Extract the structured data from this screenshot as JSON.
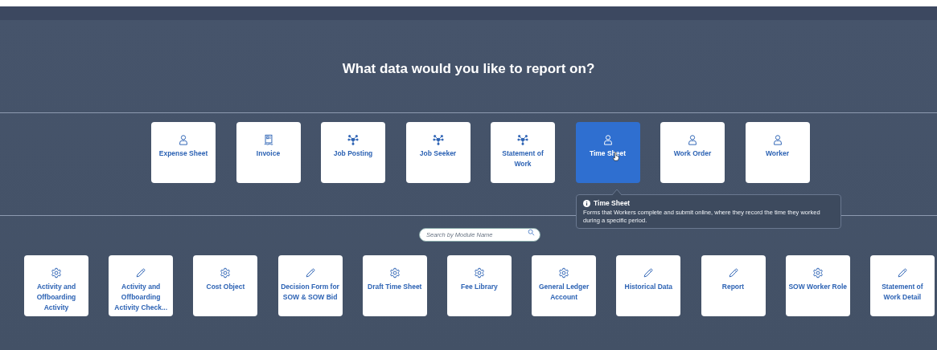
{
  "title": "What data would you like to report on?",
  "primary_modules": [
    {
      "label": "Expense Sheet",
      "kind": "user",
      "selected": false
    },
    {
      "label": "Invoice",
      "kind": "document",
      "selected": false
    },
    {
      "label": "Job Posting",
      "kind": "network",
      "selected": false
    },
    {
      "label": "Job Seeker",
      "kind": "network",
      "selected": false
    },
    {
      "label": "Statement of Work",
      "kind": "network",
      "selected": false
    },
    {
      "label": "Time Sheet",
      "kind": "user",
      "selected": true
    },
    {
      "label": "Work Order",
      "kind": "user",
      "selected": false
    },
    {
      "label": "Worker",
      "kind": "user",
      "selected": false
    }
  ],
  "tooltip": {
    "title": "Time Sheet",
    "text": "Forms that Workers complete and submit online, where they record the time they worked during a specific period."
  },
  "search": {
    "placeholder": "Search by Module Name"
  },
  "other_modules": [
    {
      "label": "Activity and Offboarding Activity",
      "kind": "setting"
    },
    {
      "label": "Activity and Offboarding Activity Check...",
      "kind": "edit"
    },
    {
      "label": "Cost Object",
      "kind": "setting"
    },
    {
      "label": "Decision Form for SOW & SOW Bid",
      "kind": "edit"
    },
    {
      "label": "Draft Time Sheet",
      "kind": "setting"
    },
    {
      "label": "Fee Library",
      "kind": "setting"
    },
    {
      "label": "General Ledger Account",
      "kind": "setting"
    },
    {
      "label": "Historical Data",
      "kind": "edit"
    },
    {
      "label": "Report",
      "kind": "edit"
    },
    {
      "label": "SOW Worker Role",
      "kind": "setting"
    },
    {
      "label": "Statement of Work Detail",
      "kind": "edit"
    }
  ]
}
